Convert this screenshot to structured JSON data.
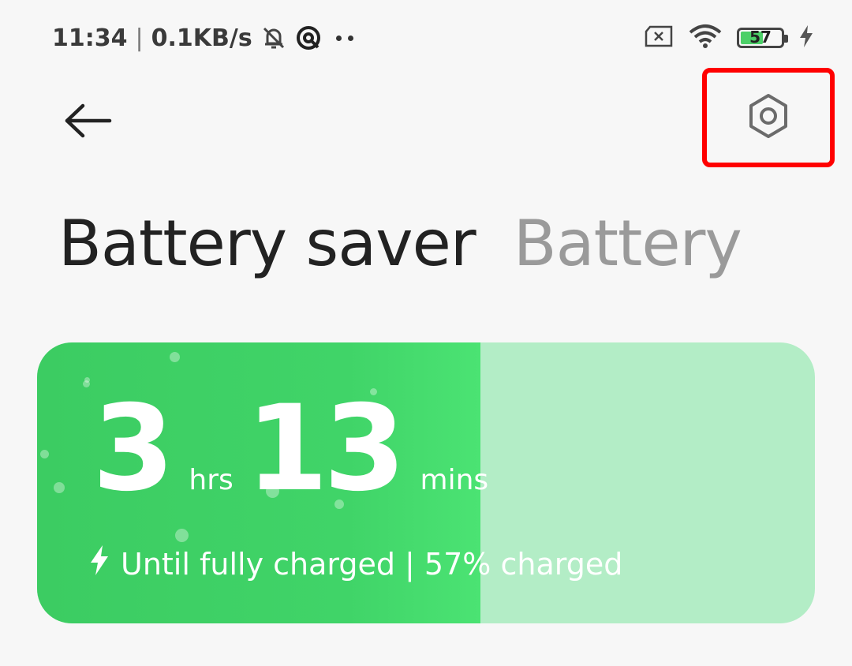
{
  "status_bar": {
    "time": "11:34",
    "separator": "|",
    "net_speed": "0.1KB/s",
    "battery_level": "57",
    "battery_fraction": 0.57,
    "icons": [
      "muted-bell-icon",
      "vpn-icon",
      "more-notifications-icon",
      "no-sim-icon",
      "wifi-icon",
      "battery-icon",
      "charging-bolt-icon"
    ]
  },
  "header": {
    "back_icon": "arrow-left-icon",
    "settings_icon": "hexagon-gear-icon",
    "highlight_color": "#ff0000"
  },
  "tabs": [
    {
      "label": "Battery saver",
      "active": true
    },
    {
      "label": "Battery",
      "active": false
    }
  ],
  "battery_card": {
    "hours": "3",
    "hours_unit": "hrs",
    "minutes": "13",
    "minutes_unit": "mins",
    "status": "Until fully charged | 57% charged",
    "charge_fraction": 0.57,
    "fill_color": "#40d468",
    "track_color": "#b3edc6"
  }
}
